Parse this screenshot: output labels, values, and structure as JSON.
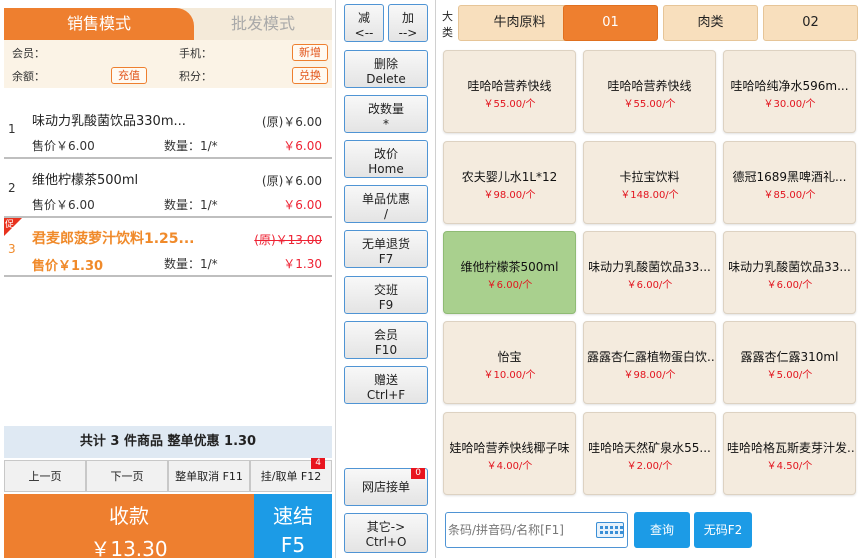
{
  "modes": {
    "retail": "销售模式",
    "wholesale": "批发模式"
  },
  "member": {
    "member_label": "会员：",
    "phone_label": "手机：",
    "balance_label": "余额：",
    "points_label": "积分：",
    "add_btn": "新增",
    "recharge_btn": "充值",
    "exchange_btn": "兑换"
  },
  "cart": [
    {
      "idx": "1",
      "name": "味动力乳酸菌饮品330m...",
      "orig": "(原)￥6.00",
      "price": "售价￥6.00",
      "qty": "数量：1/*",
      "subtotal": "￥6.00"
    },
    {
      "idx": "2",
      "name": "维他柠檬茶500ml",
      "orig": "(原)￥6.00",
      "price": "售价￥6.00",
      "qty": "数量：1/*",
      "subtotal": "￥6.00"
    },
    {
      "idx": "3",
      "name": "君麦郎菠萝汁饮料1.25...",
      "orig": "(原)￥13.00",
      "price": "售价￥1.30",
      "qty": "数量：1/*",
      "subtotal": "￥1.30",
      "promo_tag": "促"
    }
  ],
  "summary": "共计 3 件商品 整单优惠 1.30",
  "pager": {
    "prev": "上一页",
    "next": "下一页",
    "cancel_order": "整单取消 F11",
    "hold_order": "挂/取单 F12",
    "hold_badge": "4"
  },
  "pay": {
    "label": "收款",
    "amount": "￥13.30"
  },
  "quick": {
    "label": "速结",
    "key": "F5"
  },
  "functions": {
    "minus": {
      "label": "减",
      "key": "<--"
    },
    "plus": {
      "label": "加",
      "key": "-->"
    },
    "delete": {
      "label": "删除",
      "key": "Delete"
    },
    "change_qty": {
      "label": "改数量",
      "key": "*"
    },
    "change_price": {
      "label": "改价",
      "key": "Home"
    },
    "item_discount": {
      "label": "单品优惠",
      "key": "/"
    },
    "refund": {
      "label": "无单退货",
      "key": "F7"
    },
    "shift": {
      "label": "交班",
      "key": "F9"
    },
    "member": {
      "label": "会员",
      "key": "F10"
    },
    "gift": {
      "label": "赠送",
      "key": "Ctrl+F"
    },
    "online": {
      "label": "网店接单",
      "badge": "0"
    },
    "other": {
      "label": "其它->",
      "key": "Ctrl+O"
    }
  },
  "categories": {
    "label": "大类",
    "tabs": [
      "牛肉原料",
      "01",
      "肉类",
      "02"
    ],
    "selected": "01"
  },
  "products": [
    {
      "name": "哇哈哈营养快线",
      "price": "￥55.00/个"
    },
    {
      "name": "哇哈哈营养快线",
      "price": "￥55.00/个"
    },
    {
      "name": "哇哈哈纯净水596m...",
      "price": "￥30.00/个"
    },
    {
      "name": "农夫婴儿水1L*12",
      "price": "￥98.00/个"
    },
    {
      "name": "卡拉宝饮料",
      "price": "￥148.00/个"
    },
    {
      "name": "德冠1689黑啤酒礼...",
      "price": "￥85.00/个"
    },
    {
      "name": "维他柠檬茶500ml",
      "price": "￥6.00/个",
      "selected": true
    },
    {
      "name": "味动力乳酸菌饮品33...",
      "price": "￥6.00/个"
    },
    {
      "name": "味动力乳酸菌饮品33...",
      "price": "￥6.00/个"
    },
    {
      "name": "怡宝",
      "price": "￥10.00/个"
    },
    {
      "name": "露露杏仁露植物蛋白饮...",
      "price": "￥98.00/个"
    },
    {
      "name": "露露杏仁露310ml",
      "price": "￥5.00/个"
    },
    {
      "name": "娃哈哈营养快线椰子味",
      "price": "￥4.00/个"
    },
    {
      "name": "哇哈哈天然矿泉水55...",
      "price": "￥2.00/个"
    },
    {
      "name": "哇哈哈格瓦斯麦芽汁发...",
      "price": "￥4.50/个"
    }
  ],
  "search": {
    "placeholder": "条码/拼音码/名称[F1]",
    "value": ""
  },
  "actions": {
    "query": "查询",
    "no_code": "无码F2"
  },
  "colors": {
    "accent": "#ee7f2f",
    "blue": "#1c9be6",
    "price_red": "#e2141e",
    "selected_green": "#a9d08e"
  }
}
